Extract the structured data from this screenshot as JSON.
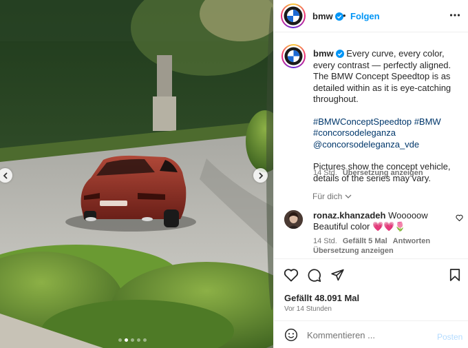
{
  "post": {
    "username": "bmw",
    "follow_label": "Folgen",
    "separator": "•",
    "caption_text": "Every curve, every color, every contrast — perfectly aligned. The BMW Concept Speedtop is as detailed within as it is eye-catching throughout.",
    "hashtags": "#BMWConceptSpeedtop #BMW #concorsodeleganza @concorsodeleganza_vde",
    "caption_note": "Pictures show the concept vehicle, details of the series may vary.",
    "caption_age": "14 Std.",
    "translate_label": "Übersetzung anzeigen",
    "for_you_label": "Für dich",
    "likes_label": "Gefällt 48.091 Mal",
    "posted_ago": "Vor 14 Stunden",
    "comment_placeholder": "Kommentieren ...",
    "post_label": "Posten"
  },
  "comment": {
    "username": "ronaz.khanzadeh",
    "text": "Wooooow Beautiful color 💗💗🌷",
    "age": "14 Std.",
    "likes": "Gefällt 5 Mal",
    "reply_label": "Antworten",
    "translate_label": "Übersetzung anzeigen"
  },
  "carousel": {
    "slide_count": 5,
    "active_index": 1
  },
  "icons": {
    "verified": "verified-badge-icon",
    "more": "more-horizontal-icon",
    "like": "heart-icon",
    "comment": "comment-icon",
    "share": "paper-plane-icon",
    "save": "bookmark-icon",
    "emoji": "emoji-icon",
    "prev": "chevron-left-icon",
    "next": "chevron-right-icon"
  },
  "colors": {
    "accent": "#0095f6",
    "text": "#262626",
    "muted": "#737373",
    "link": "#00376b",
    "verified": "#0095f6"
  }
}
